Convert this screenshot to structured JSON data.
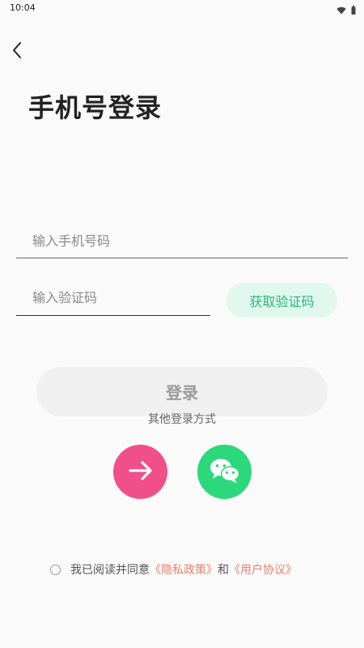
{
  "status_bar": {
    "time": "10:04",
    "icons": [
      "wifi-icon",
      "battery-icon"
    ]
  },
  "header": {
    "back_icon": "chevron-left-icon",
    "title": "手机号登录"
  },
  "form": {
    "phone": {
      "value": "",
      "placeholder": "输入手机号码"
    },
    "code": {
      "value": "",
      "placeholder": "输入验证码"
    },
    "get_code_label": "获取验证码",
    "login_label": "登录"
  },
  "other_login": {
    "label": "其他登录方式",
    "methods": [
      {
        "icon": "arrow-right-icon",
        "color": "#f0508a"
      },
      {
        "icon": "wechat-icon",
        "color": "#2bd87b"
      }
    ]
  },
  "agreement": {
    "checked": false,
    "prefix": "我已阅读并同意",
    "privacy_link": "《隐私政策》",
    "conjunction": "和",
    "terms_link": "《用户协议》"
  },
  "colors": {
    "background": "#fafafa",
    "accent_green": "#2bb57e",
    "accent_green_bg": "#e0f8ee",
    "link": "#ef7f6b",
    "pink": "#f0508a",
    "wechat_green": "#2bd87b"
  }
}
